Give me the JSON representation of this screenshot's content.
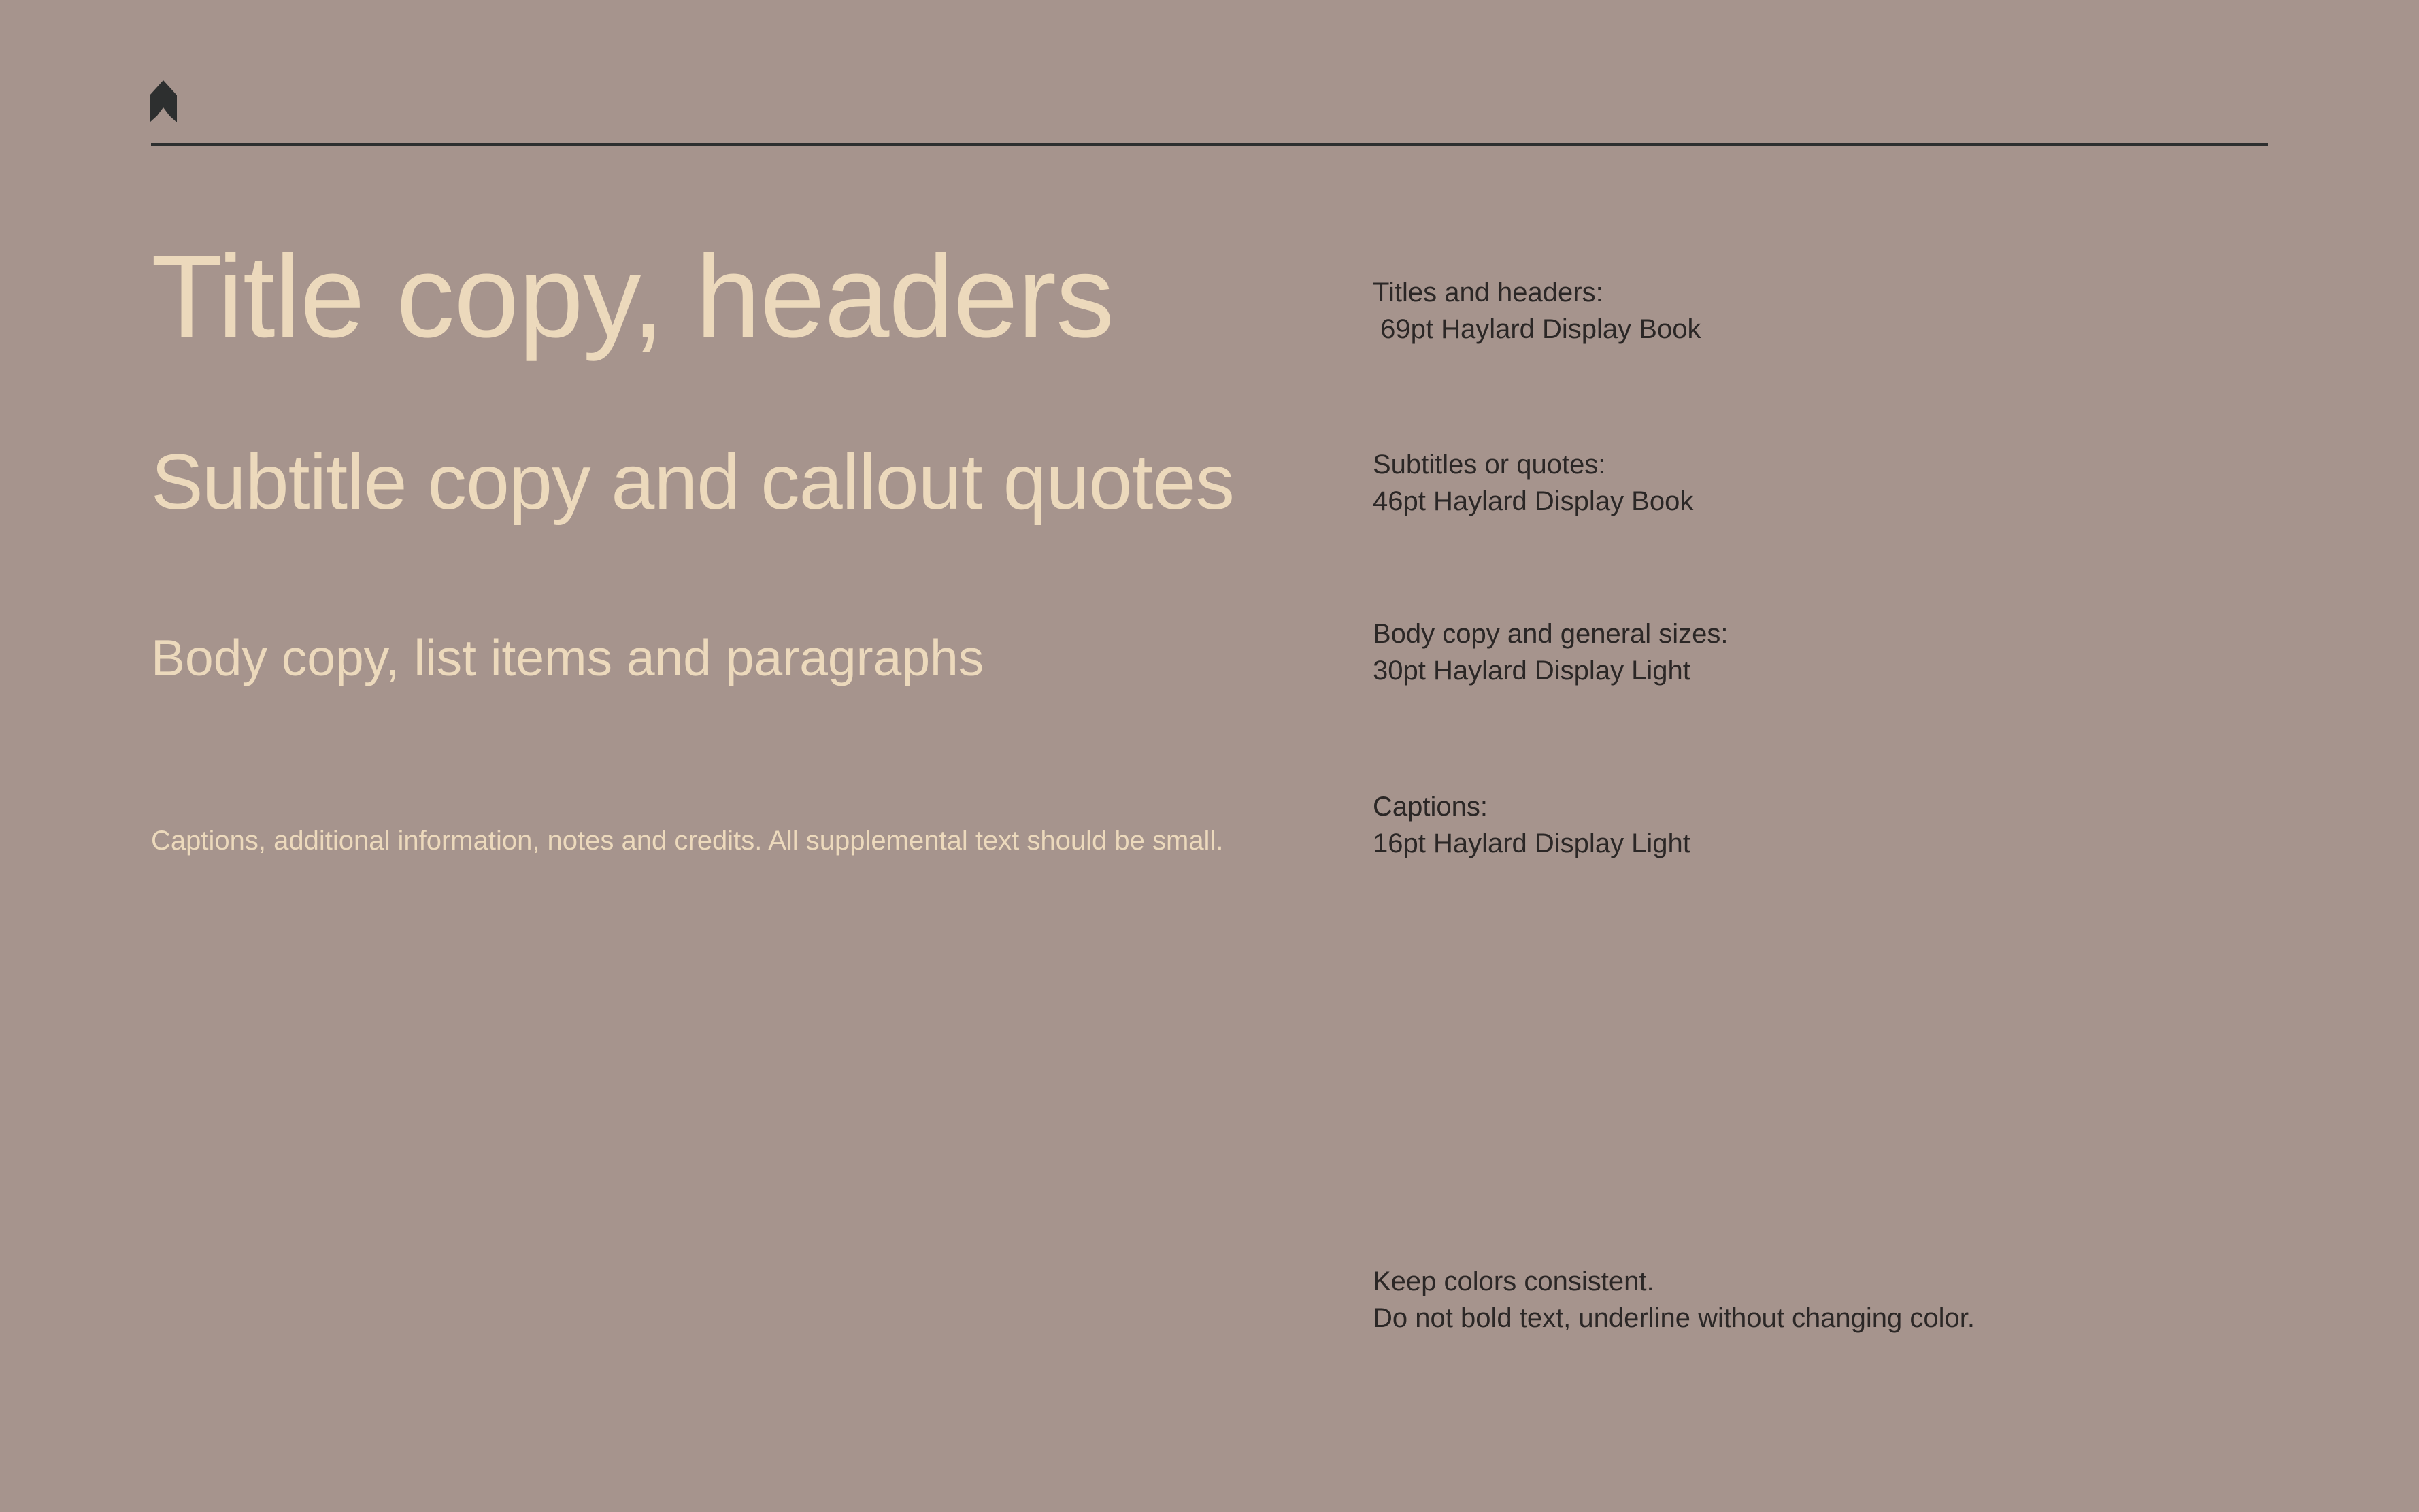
{
  "colors": {
    "background": "#a6948d",
    "sample_text": "#ecd9bc",
    "spec_text": "#2b2726",
    "rule": "#2d2f2f"
  },
  "brand": {
    "logo_icon": "arch-house-logo-icon"
  },
  "samples": {
    "title": "Title copy, headers",
    "subtitle": "Subtitle copy and callout quotes",
    "body": "Body copy, list items and paragraphs",
    "caption": "Captions, additional information, notes and credits. All supplemental text should be small."
  },
  "specs": [
    {
      "label": "Titles and headers:",
      "value": " 69pt Haylard Display Book"
    },
    {
      "label": "Subtitles or quotes:",
      "value": "46pt Haylard Display Book"
    },
    {
      "label": "Body copy and general sizes:",
      "value": "30pt Haylard Display Light"
    },
    {
      "label": "Captions:",
      "value": "16pt Haylard Display Light"
    }
  ],
  "notes": {
    "line1": "Keep colors consistent.",
    "line2": "Do not bold text, underline without changing color."
  }
}
